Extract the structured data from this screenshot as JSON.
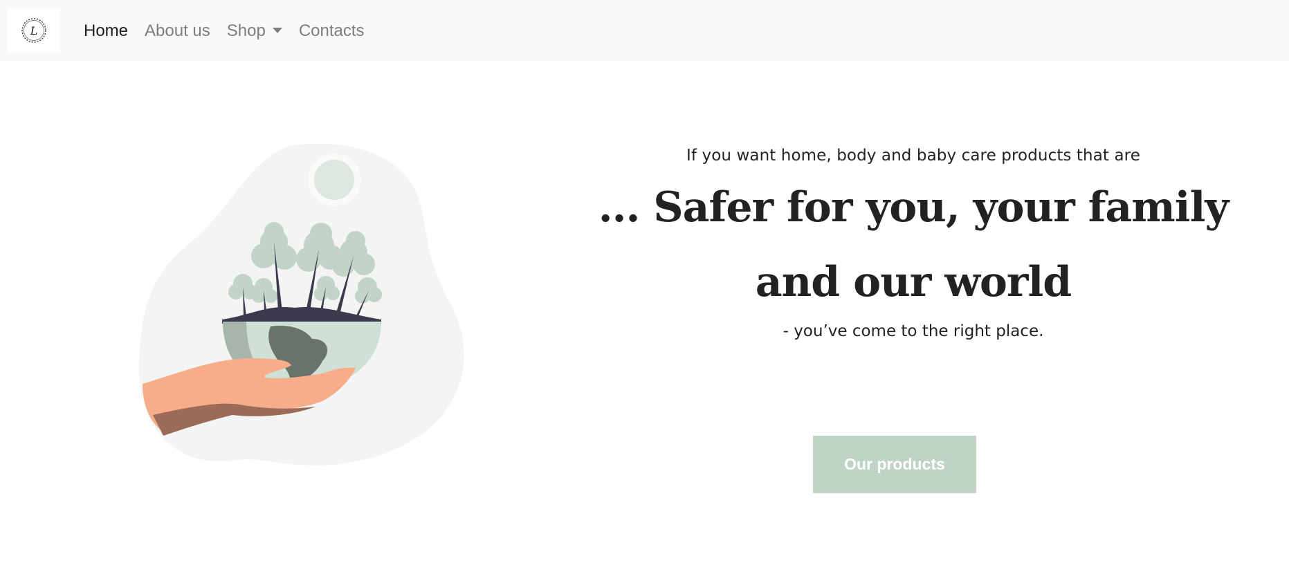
{
  "navbar": {
    "brand_logo": "script-letter-L-wreath-logo",
    "items": [
      {
        "label": "Home",
        "active": true
      },
      {
        "label": "About us",
        "active": false
      },
      {
        "label": "Shop",
        "active": false,
        "dropdown": true
      },
      {
        "label": "Contacts",
        "active": false
      }
    ]
  },
  "hero": {
    "intro": "If you want home, body and baby care products that are",
    "headline": "... Safer for you, your family and our world",
    "outro": "- you’ve come to the right place.",
    "cta_label": "Our products",
    "illustration": "hand-holding-earth-with-trees-illustration"
  },
  "colors": {
    "navbar_bg": "#f8f9fa",
    "cta_bg": "#c0d4c6",
    "cta_text": "#ffffff",
    "text": "#222222",
    "nav_inactive": "#7d7d7d"
  }
}
